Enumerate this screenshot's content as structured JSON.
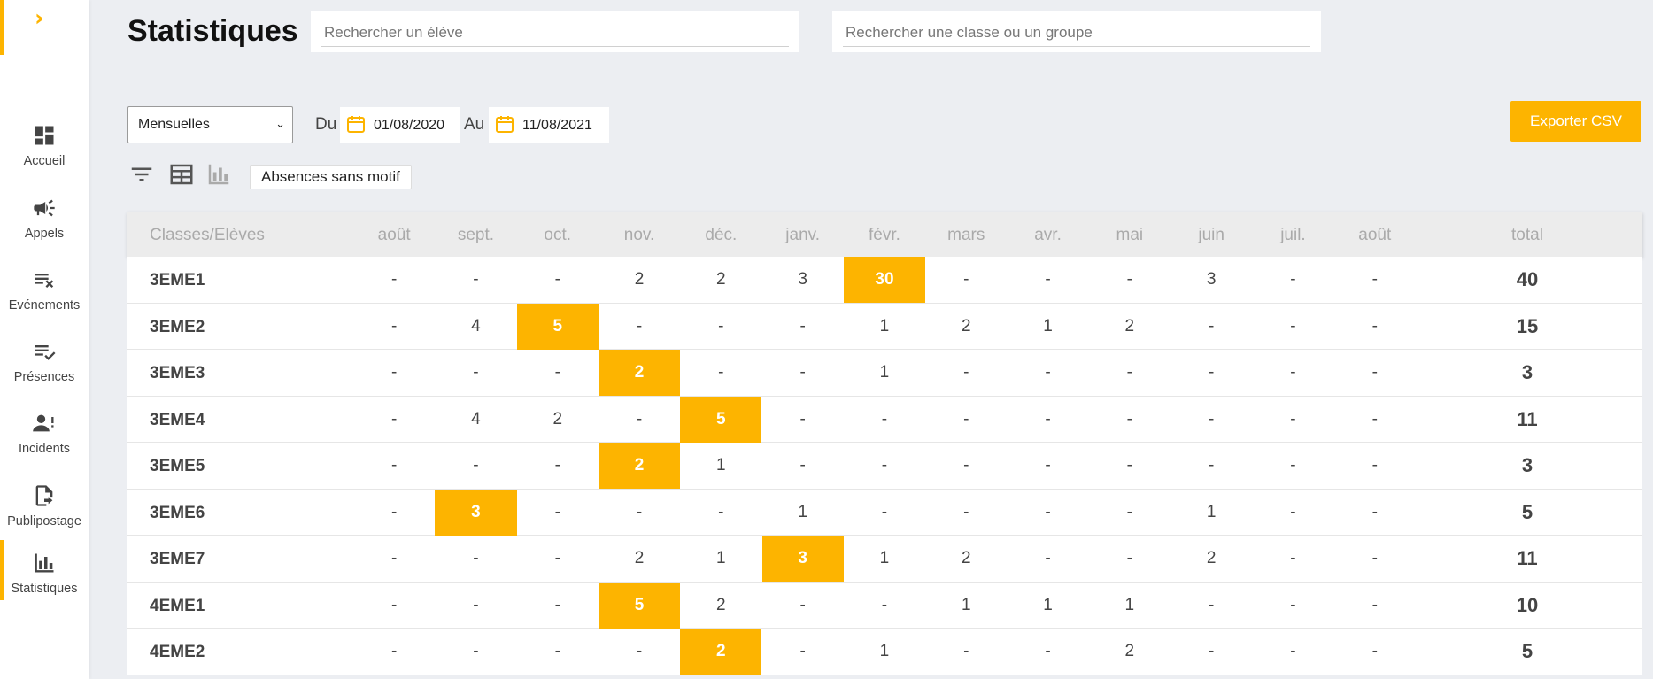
{
  "sidebar": {
    "toggle_icon": "chevron-right-icon",
    "items": [
      {
        "label": "Accueil",
        "icon": "dashboard-icon"
      },
      {
        "label": "Appels",
        "icon": "megaphone-icon"
      },
      {
        "label": "Evénements",
        "icon": "list-remove-icon"
      },
      {
        "label": "Présences",
        "icon": "list-check-icon"
      },
      {
        "label": "Incidents",
        "icon": "person-alert-icon"
      },
      {
        "label": "Publipostage",
        "icon": "file-export-icon"
      },
      {
        "label": "Statistiques",
        "icon": "bar-chart-icon",
        "active": true
      }
    ]
  },
  "header": {
    "title": "Statistiques",
    "search_student_placeholder": "Rechercher un élève",
    "search_class_placeholder": "Rechercher une classe ou un groupe"
  },
  "filters": {
    "period": "Mensuelles",
    "from_label": "Du",
    "from_date": "01/08/2020",
    "to_label": "Au",
    "to_date": "11/08/2021",
    "export_label": "Exporter CSV",
    "indicator_chip": "Absences sans motif"
  },
  "colors": {
    "accent": "#fdb400"
  },
  "table": {
    "headers": [
      "Classes/Elèves",
      "août",
      "sept.",
      "oct.",
      "nov.",
      "déc.",
      "janv.",
      "févr.",
      "mars",
      "avr.",
      "mai",
      "juin",
      "juil.",
      "août",
      "total"
    ],
    "rows": [
      {
        "name": "3EME1",
        "values": [
          "-",
          "-",
          "-",
          "2",
          "2",
          "3",
          "30",
          "-",
          "-",
          "-",
          "3",
          "-",
          "-"
        ],
        "highlight": 6,
        "total": "40"
      },
      {
        "name": "3EME2",
        "values": [
          "-",
          "4",
          "5",
          "-",
          "-",
          "-",
          "1",
          "2",
          "1",
          "2",
          "-",
          "-",
          "-"
        ],
        "highlight": 2,
        "total": "15"
      },
      {
        "name": "3EME3",
        "values": [
          "-",
          "-",
          "-",
          "2",
          "-",
          "-",
          "1",
          "-",
          "-",
          "-",
          "-",
          "-",
          "-"
        ],
        "highlight": 3,
        "total": "3"
      },
      {
        "name": "3EME4",
        "values": [
          "-",
          "4",
          "2",
          "-",
          "5",
          "-",
          "-",
          "-",
          "-",
          "-",
          "-",
          "-",
          "-"
        ],
        "highlight": 4,
        "total": "11"
      },
      {
        "name": "3EME5",
        "values": [
          "-",
          "-",
          "-",
          "2",
          "1",
          "-",
          "-",
          "-",
          "-",
          "-",
          "-",
          "-",
          "-"
        ],
        "highlight": 3,
        "total": "3"
      },
      {
        "name": "3EME6",
        "values": [
          "-",
          "3",
          "-",
          "-",
          "-",
          "1",
          "-",
          "-",
          "-",
          "-",
          "1",
          "-",
          "-"
        ],
        "highlight": 1,
        "total": "5"
      },
      {
        "name": "3EME7",
        "values": [
          "-",
          "-",
          "-",
          "2",
          "1",
          "3",
          "1",
          "2",
          "-",
          "-",
          "2",
          "-",
          "-"
        ],
        "highlight": 5,
        "total": "11"
      },
      {
        "name": "4EME1",
        "values": [
          "-",
          "-",
          "-",
          "5",
          "2",
          "-",
          "-",
          "1",
          "1",
          "1",
          "-",
          "-",
          "-"
        ],
        "highlight": 3,
        "total": "10"
      },
      {
        "name": "4EME2",
        "values": [
          "-",
          "-",
          "-",
          "-",
          "2",
          "-",
          "1",
          "-",
          "-",
          "2",
          "-",
          "-",
          "-"
        ],
        "highlight": 4,
        "total": "5"
      }
    ]
  }
}
